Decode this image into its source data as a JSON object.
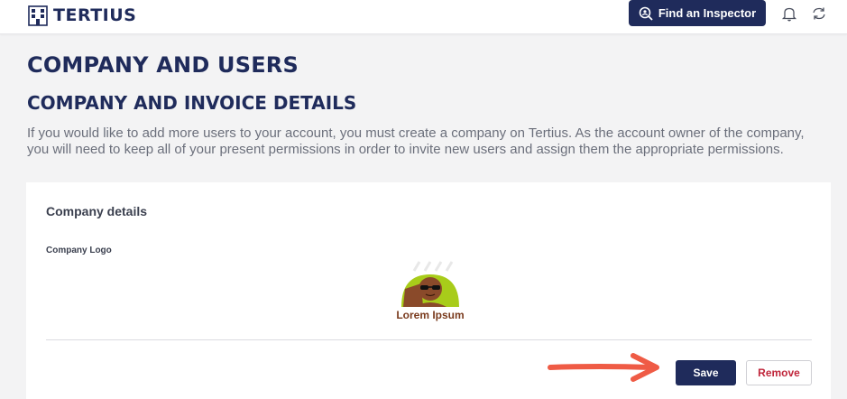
{
  "header": {
    "brand": "TERTIUS",
    "find_inspector_label": "Find an Inspector",
    "icons": [
      "building-logo-icon",
      "inspector-search-icon",
      "bell-icon",
      "sync-icon"
    ]
  },
  "page": {
    "title": "COMPANY AND USERS",
    "section_title": "COMPANY AND INVOICE DETAILS",
    "description": "If you would like to add more users to your account, you must create a company on Tertius. As the account owner of the company, you will need to keep all of your present permissions in order to invite new users and assign them the appropriate permissions."
  },
  "card": {
    "title": "Company details",
    "logo_label": "Company Logo",
    "logo_text": "Lorem Ipsum",
    "save_label": "Save",
    "remove_label": "Remove"
  },
  "colors": {
    "brand_navy": "#1f2b5b",
    "remove_red": "#c0263b",
    "annotation_arrow": "#ef5b45",
    "page_bg": "#f3f3f4"
  }
}
